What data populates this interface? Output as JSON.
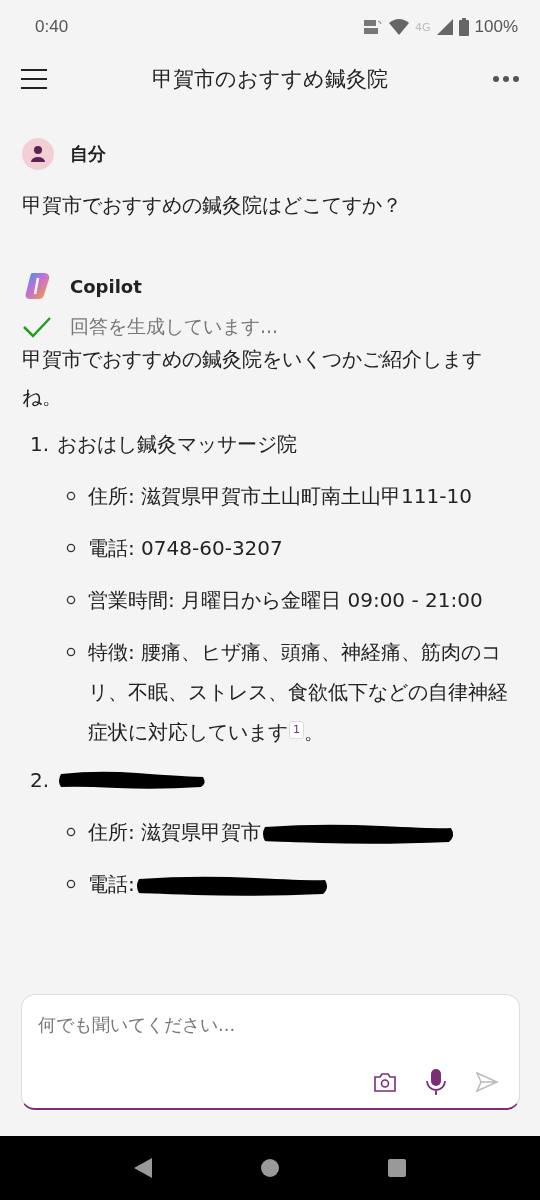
{
  "status_bar": {
    "time": "0:40",
    "network": "4G",
    "battery": "100%"
  },
  "header": {
    "title": "甲賀市のおすすめ鍼灸院"
  },
  "messages": [
    {
      "kind": "user",
      "author": "自分",
      "text": "甲賀市でおすすめの鍼灸院はどこてすか？"
    },
    {
      "kind": "bot",
      "author": "Copilot",
      "status": "回答を生成しています...",
      "done": true,
      "intro": "甲賀市でおすすめの鍼灸院をいくつかご紹介しますね。",
      "items": [
        {
          "number": "1.",
          "name": "おおはし鍼灸マッサージ院",
          "redacted": false,
          "details": [
            {
              "text": "住所: 滋賀県甲賀市土山町南土山甲111-10",
              "redacted": false
            },
            {
              "text": "電話: 0748-60-3207",
              "redacted": false
            },
            {
              "text": "営業時間: 月曜日から金曜日 09:00 - 21:00",
              "redacted": false
            },
            {
              "text": "特徴: 腰痛、ヒザ痛、頭痛、神経痛、筋肉のコリ、不眠、ストレス、食欲低下などの自律神経症状に対応しています",
              "citation": "1",
              "tail": "。",
              "redacted": false
            }
          ]
        },
        {
          "number": "2.",
          "redacted": true,
          "details": [
            {
              "text": "住所: 滋賀県甲賀市",
              "redacted": true
            },
            {
              "text": "電話:",
              "redacted": true
            }
          ]
        }
      ]
    }
  ],
  "composer": {
    "placeholder": "何でも聞いてください..."
  }
}
